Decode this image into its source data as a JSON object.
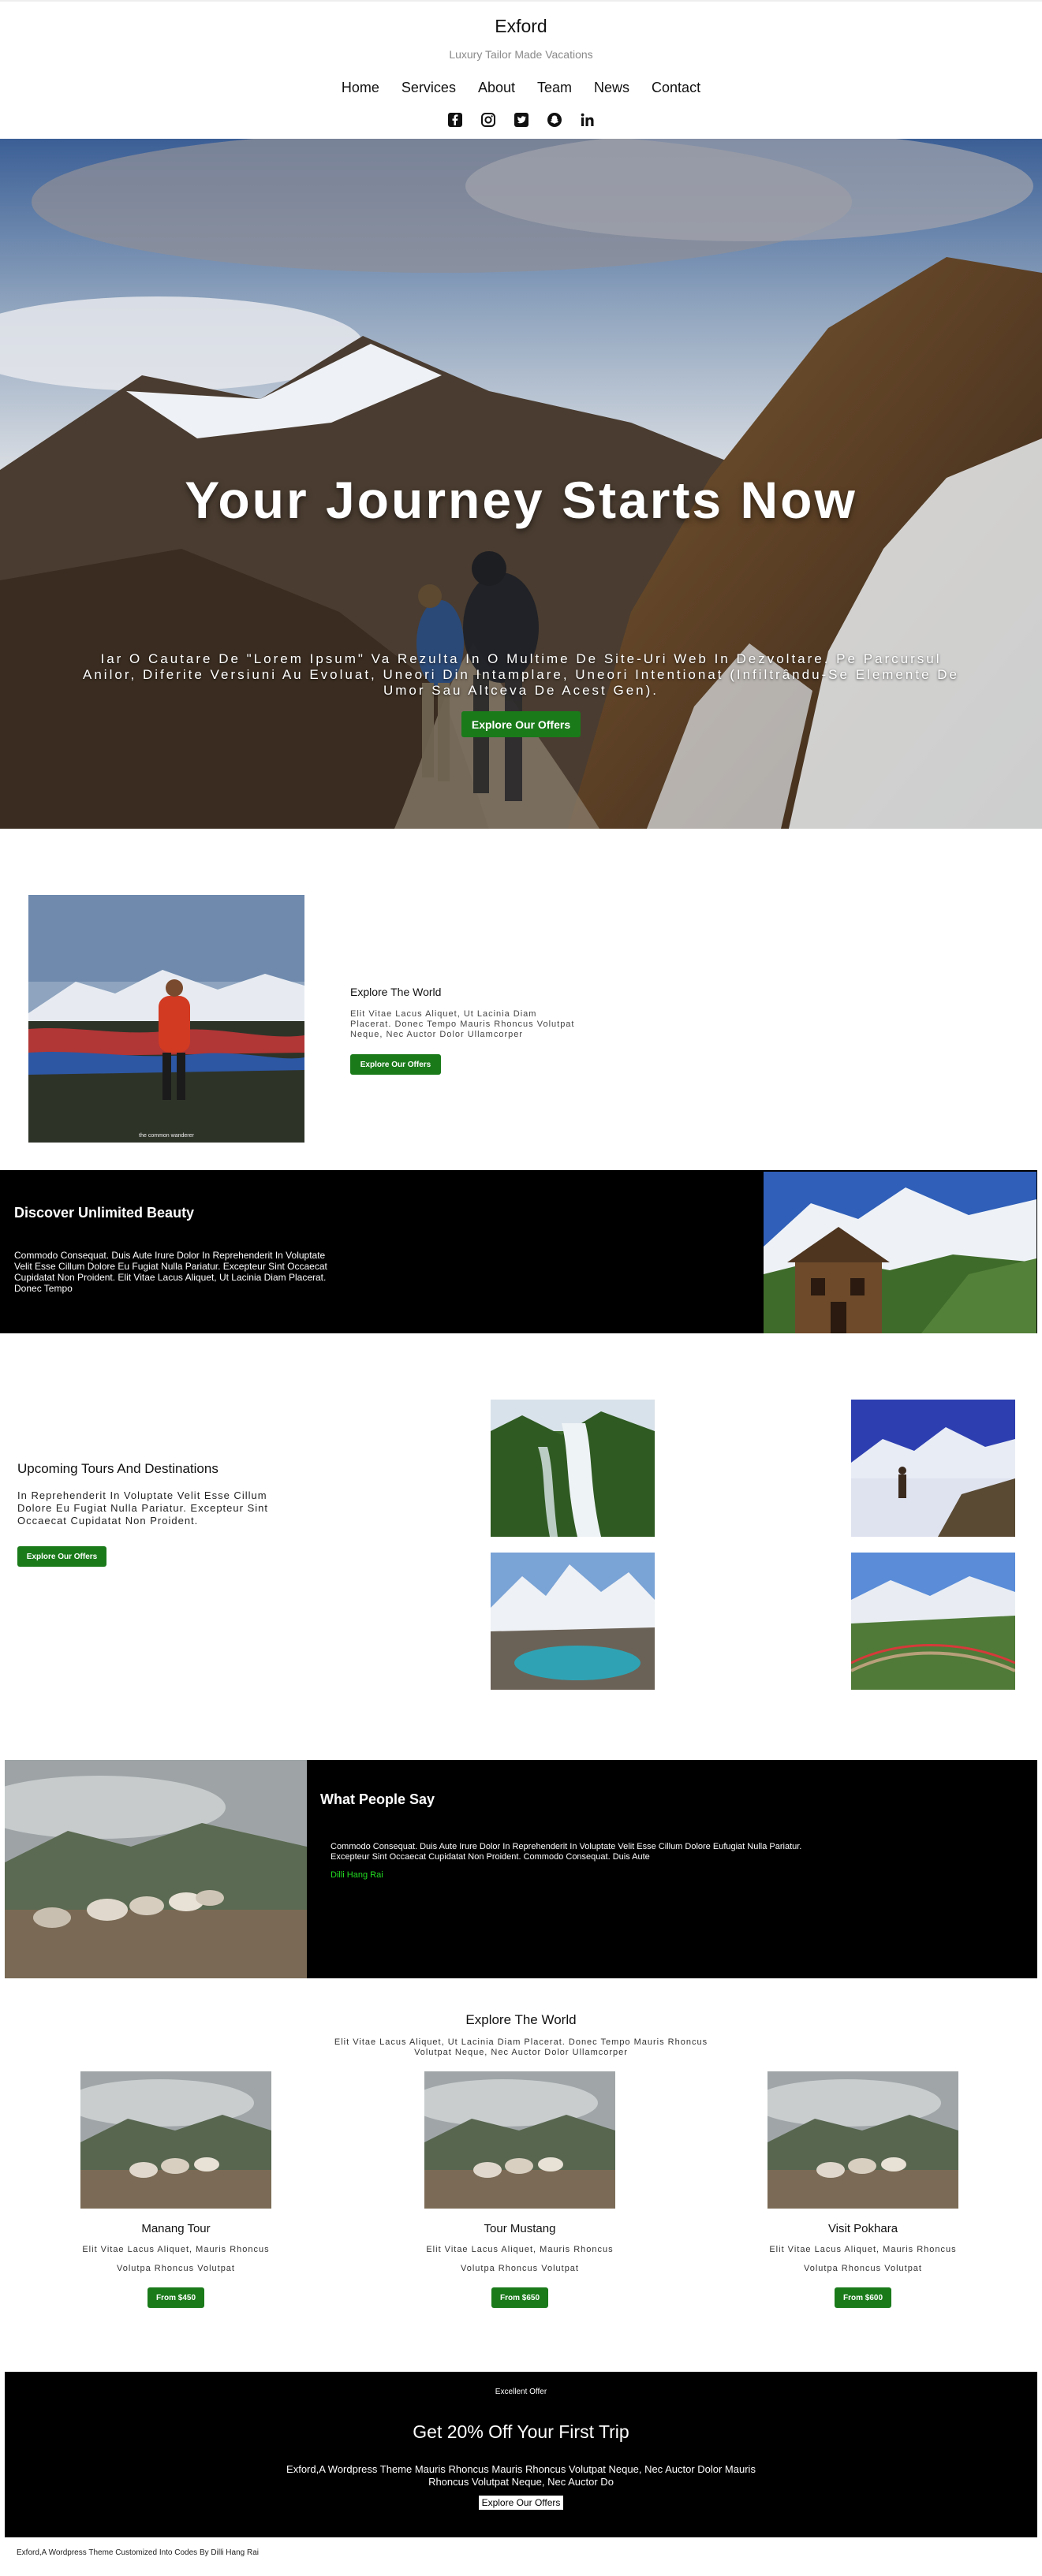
{
  "header": {
    "brand": "Exford",
    "tagline": "Luxury Tailor Made Vacations",
    "nav": [
      "Home",
      "Services",
      "About",
      "Team",
      "News",
      "Contact"
    ],
    "social_icons": [
      "facebook-icon",
      "instagram-icon",
      "twitter-icon",
      "snapchat-icon",
      "linkedin-icon"
    ]
  },
  "hero": {
    "title": "Your Journey Starts Now",
    "text": "Iar O Cautare De \"Lorem Ipsum\" Va Rezulta In O Multime De Site-Uri Web In Dezvoltare. Pe Parcursul Anilor, Diferite Versiuni Au Evoluat, Uneori Din Intamplare, Uneori Intentionat (Infiltrându-Se Elemente De Umor Sau Altceva De Acest Gen).",
    "button": "Explore Our Offers"
  },
  "explore": {
    "title": "Explore The World",
    "text": "Elit Vitae Lacus Aliquet, Ut Lacinia Diam Placerat. Donec Tempo Mauris Rhoncus Volutpat Neque, Nec Auctor Dolor Ullamcorper",
    "button": "Explore Our Offers",
    "image_caption": "the common wanderer"
  },
  "discover": {
    "title": "Discover Unlimited Beauty",
    "text": "Commodo Consequat. Duis Aute Irure Dolor In Reprehenderit In Voluptate Velit Esse Cillum Dolore Eu Fugiat Nulla Pariatur. Excepteur Sint Occaecat Cupidatat Non Proident. Elit Vitae Lacus Aliquet, Ut Lacinia Diam Placerat. Donec Tempo"
  },
  "tours": {
    "title": "Upcoming Tours And Destinations",
    "text": "In Reprehenderit In Voluptate Velit Esse Cillum Dolore Eu Fugiat Nulla Pariatur. Excepteur Sint Occaecat Cupidatat Non Proident.",
    "button": "Explore Our Offers"
  },
  "testimonial": {
    "title": "What People Say",
    "quote": "Commodo Consequat. Duis Aute Irure Dolor In Reprehenderit In Voluptate Velit Esse Cillum Dolore Eufugiat Nulla Pariatur. Excepteur Sint Occaecat Cupidatat Non Proident. Commodo Consequat. Duis Aute",
    "author": "Dilli Hang Rai"
  },
  "packages": {
    "title": "Explore The World",
    "text": "Elit Vitae Lacus Aliquet, Ut Lacinia Diam Placerat. Donec Tempo Mauris Rhoncus Volutpat Neque, Nec Auctor Dolor Ullamcorper",
    "cards": [
      {
        "name": "Manang Tour",
        "text": "Elit Vitae Lacus Aliquet, Mauris Rhoncus Volutpa Rhoncus Volutpat",
        "price": "From $450"
      },
      {
        "name": "Tour Mustang",
        "text": "Elit Vitae Lacus Aliquet, Mauris Rhoncus Volutpa Rhoncus Volutpat",
        "price": "From $650"
      },
      {
        "name": "Visit Pokhara",
        "text": "Elit Vitae Lacus Aliquet, Mauris Rhoncus Volutpa Rhoncus Volutpat",
        "price": "From $600"
      }
    ]
  },
  "cta": {
    "eyebrow": "Excellent Offer",
    "title": "Get 20% Off Your First Trip",
    "text": "Exford,A Wordpress Theme Mauris Rhoncus Mauris Rhoncus Volutpat Neque, Nec Auctor Dolor Mauris Rhoncus Volutpat Neque, Nec Auctor Do",
    "button": "Explore Our Offers"
  },
  "footer": {
    "note": "Exford,A Wordpress Theme Customized Into Codes By Dilli Hang Rai"
  },
  "colors": {
    "accent_green": "#1a7a1a",
    "author_green": "#22dd22",
    "band_black": "#000000"
  }
}
